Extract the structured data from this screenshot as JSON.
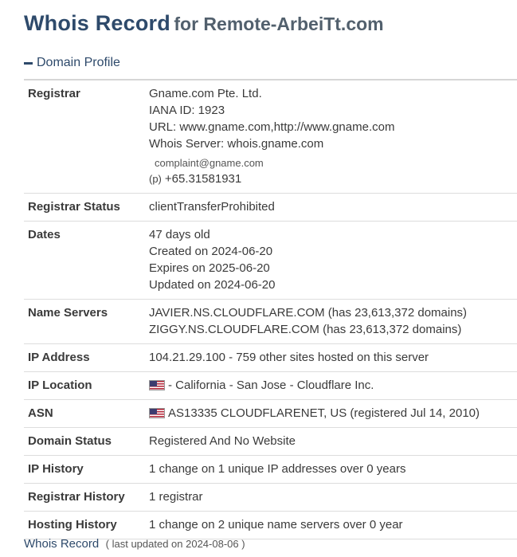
{
  "header": {
    "title": "Whois Record",
    "subtitle": "for Remote-ArbeiTt.com"
  },
  "section": {
    "label": "Domain Profile"
  },
  "rows": {
    "registrar": {
      "label": "Registrar",
      "name": "Gname.com Pte. Ltd.",
      "iana": "IANA ID: 1923",
      "url": "URL: www.gname.com,http://www.gname.com",
      "whois_server": "Whois Server: whois.gname.com",
      "email": "complaint@gname.com",
      "phone_label": "(p)",
      "phone": "+65.31581931"
    },
    "registrar_status": {
      "label": "Registrar Status",
      "value": "clientTransferProhibited"
    },
    "dates": {
      "label": "Dates",
      "age": "47 days old",
      "created": "Created on 2024-06-20",
      "expires": "Expires on 2025-06-20",
      "updated": "Updated on 2024-06-20"
    },
    "name_servers": {
      "label": "Name Servers",
      "ns1": "JAVIER.NS.CLOUDFLARE.COM (has 23,613,372 domains)",
      "ns2": "ZIGGY.NS.CLOUDFLARE.COM (has 23,613,372 domains)"
    },
    "ip_address": {
      "label": "IP Address",
      "value": "104.21.29.100 - 759 other sites hosted on this server"
    },
    "ip_location": {
      "label": "IP Location",
      "value": "- California - San Jose - Cloudflare Inc."
    },
    "asn": {
      "label": "ASN",
      "value": "AS13335 CLOUDFLARENET, US (registered Jul 14, 2010)"
    },
    "domain_status": {
      "label": "Domain Status",
      "value": "Registered And No Website"
    },
    "ip_history": {
      "label": "IP History",
      "value": "1 change on 1 unique IP addresses over 0 years"
    },
    "registrar_history": {
      "label": "Registrar History",
      "value": "1 registrar"
    },
    "hosting_history": {
      "label": "Hosting History",
      "value": "1 change on 2 unique name servers over 0 year"
    }
  },
  "footer": {
    "title": "Whois Record",
    "note": "( last updated on 2024-08-06 )"
  },
  "icons": {
    "flag": "us-flag-icon",
    "collapse": "minus-icon"
  },
  "colors": {
    "heading": "#2e4a6b",
    "text": "#3a3a3a",
    "divider": "#dddddd"
  }
}
